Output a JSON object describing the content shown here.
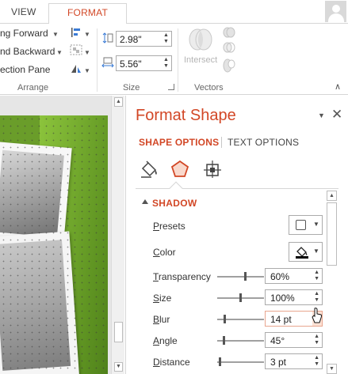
{
  "ribbon": {
    "tabs": {
      "view": "VIEW",
      "format": "FORMAT"
    },
    "arrange": {
      "bring_forward": "ng Forward",
      "send_backward": "nd Backward",
      "selection_pane": "ection Pane",
      "group_label": "Arrange"
    },
    "size": {
      "height_value": "2.98\"",
      "width_value": "5.56\"",
      "group_label": "Size"
    },
    "vectors": {
      "intersect_label": "Intersect",
      "group_label": "Vectors"
    }
  },
  "pane": {
    "title": "Format Shape",
    "tabs": {
      "shape_options": "SHAPE OPTIONS",
      "text_options": "TEXT OPTIONS"
    },
    "section": "SHADOW",
    "props": {
      "presets": {
        "pre": "",
        "key": "P",
        "post": "resets"
      },
      "color": {
        "pre": "",
        "key": "C",
        "post": "olor"
      },
      "transparency": {
        "pre": "",
        "key": "T",
        "post": "ransparency",
        "value": "60%"
      },
      "size": {
        "pre": "",
        "key": "S",
        "post": "ize",
        "value": "100%"
      },
      "blur": {
        "pre": "",
        "key": "B",
        "post": "lur",
        "value": "14 pt"
      },
      "angle": {
        "pre": "",
        "key": "A",
        "post": "ngle",
        "value": "45°"
      },
      "distance": {
        "pre": "",
        "key": "D",
        "post": "istance",
        "value": "3 pt"
      }
    },
    "slider_levels": {
      "transparency": 0.6,
      "size": 0.5,
      "blur": 0.14,
      "angle": 0.125,
      "distance": 0.03
    }
  },
  "icons": {
    "fill_line": "paint-bucket-icon",
    "effects": "pentagon-icon",
    "size_properties": "size-properties-icon"
  },
  "colors": {
    "accent": "#d24726",
    "slide_green": "#6a9d2a"
  }
}
